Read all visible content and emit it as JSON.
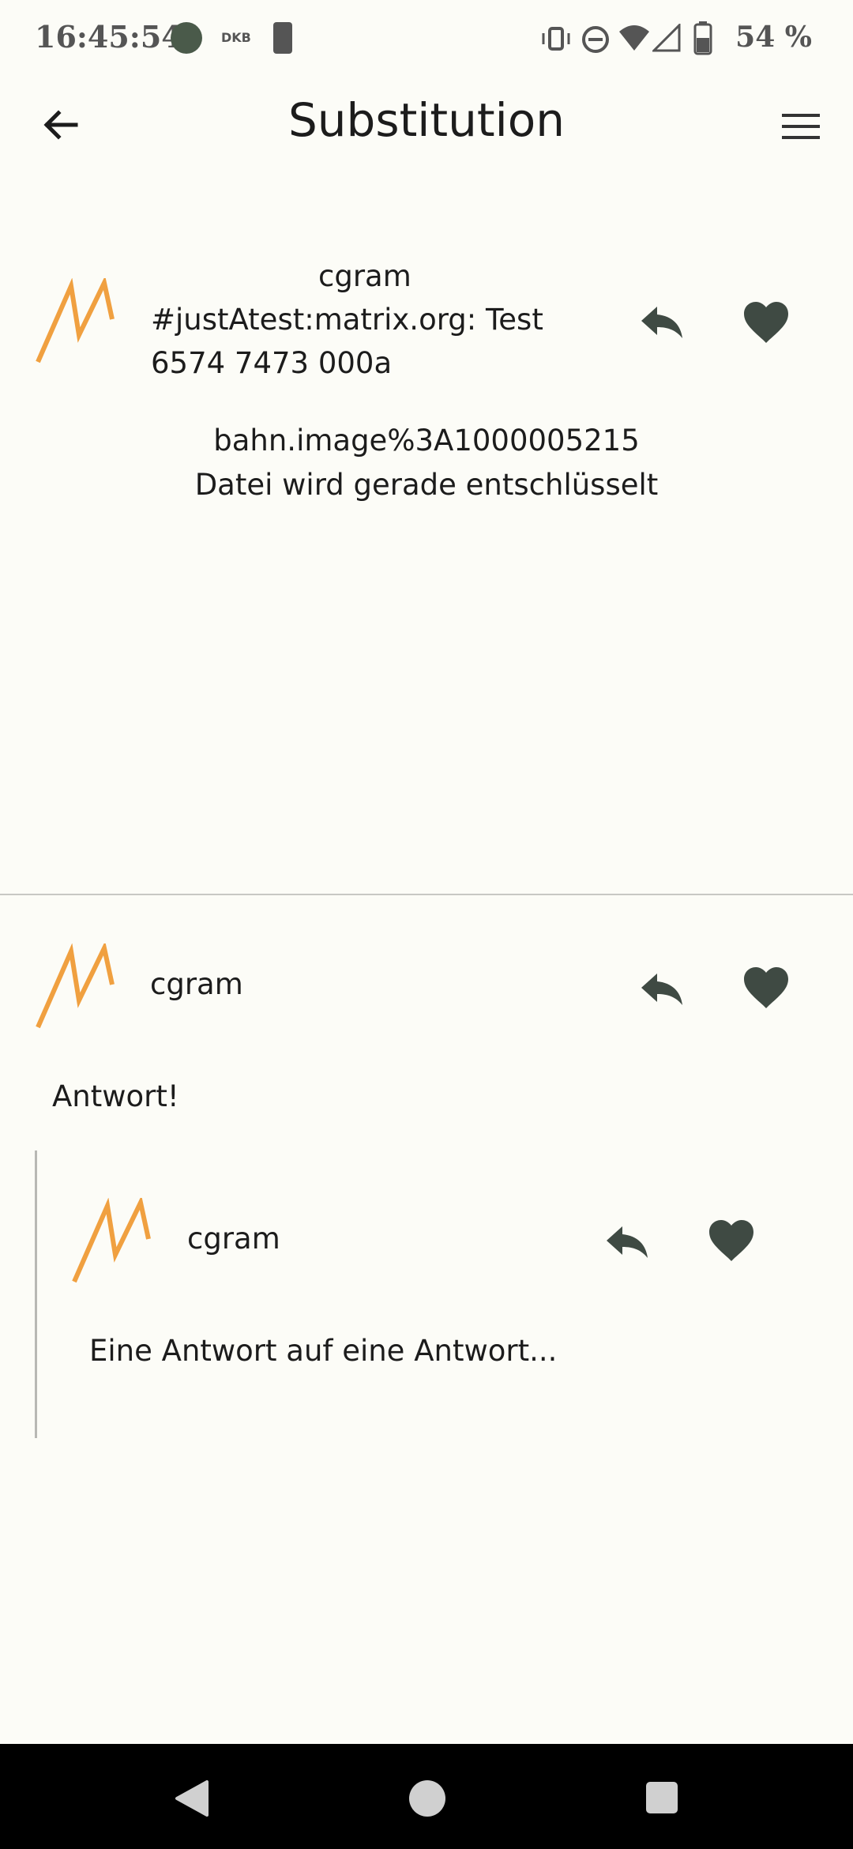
{
  "status_bar": {
    "time": "16:45:54",
    "notification_label": "DKB",
    "battery": "54 %"
  },
  "app_bar": {
    "title": "Substitution",
    "back_icon": "arrow-back-icon",
    "menu_icon": "hamburger-menu-icon"
  },
  "colors": {
    "background": "#fcfcf7",
    "avatar_logo": "#f0a040",
    "action_icon": "#3f4a43"
  },
  "post_main": {
    "author": "cgram",
    "text_line1": "#justAtest:matrix.org: Test",
    "text_line2": "6574 7473 000a",
    "file_name": "bahn.image%3A1000005215",
    "file_status": "Datei wird gerade entschlüsselt"
  },
  "reply_1": {
    "author": "cgram",
    "body": "Antwort!"
  },
  "reply_2": {
    "author": "cgram",
    "body": "Eine Antwort auf eine Antwort..."
  },
  "actions": {
    "reply_icon": "reply-icon",
    "like_icon": "heart-icon"
  }
}
